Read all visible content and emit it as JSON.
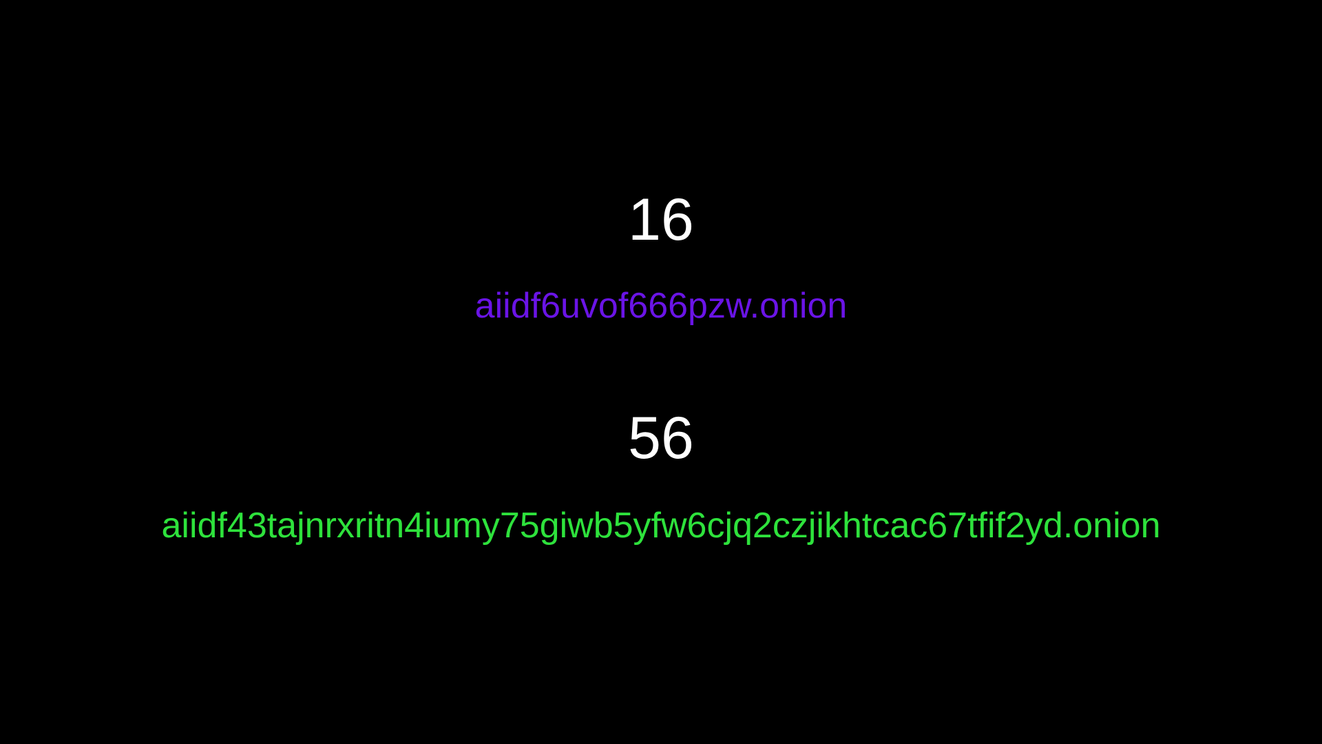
{
  "colors": {
    "background": "#000000",
    "count_text": "#ffffff",
    "v2_address": "#6a14e6",
    "v3_address": "#2ee23c"
  },
  "entries": [
    {
      "length": "16",
      "address": "aiidf6uvof666pzw.onion"
    },
    {
      "length": "56",
      "address": "aiidf43tajnrxritn4iumy75giwb5yfw6cjq2czjikhtcac67tfif2yd.onion"
    }
  ]
}
